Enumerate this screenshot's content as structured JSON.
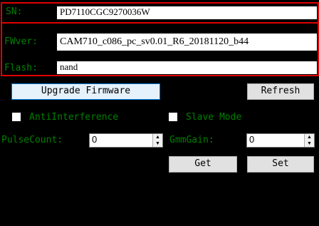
{
  "info": {
    "sn_label": "SN:",
    "sn_value": "PD7110CGC9270036W",
    "fwver_label": "FWver:",
    "fwver_value": "CAM710_c086_pc_sv0.01_R6_20181120_b44",
    "flash_label": "Flash:",
    "flash_value": "nand"
  },
  "buttons": {
    "upgrade": "Upgrade Firmware",
    "refresh": "Refresh",
    "get": "Get",
    "set": "Set"
  },
  "options": {
    "anti_interference": "AntiInterference",
    "slave_mode": "Slave Mode"
  },
  "params": {
    "pulse_count_label": "PulseCount:",
    "pulse_count_value": "0",
    "gmm_gain_label": "GmmGain:",
    "gmm_gain_value": "0"
  },
  "colors": {
    "label_green": "#008000",
    "highlight_red": "#e00000",
    "background": "#000000"
  }
}
